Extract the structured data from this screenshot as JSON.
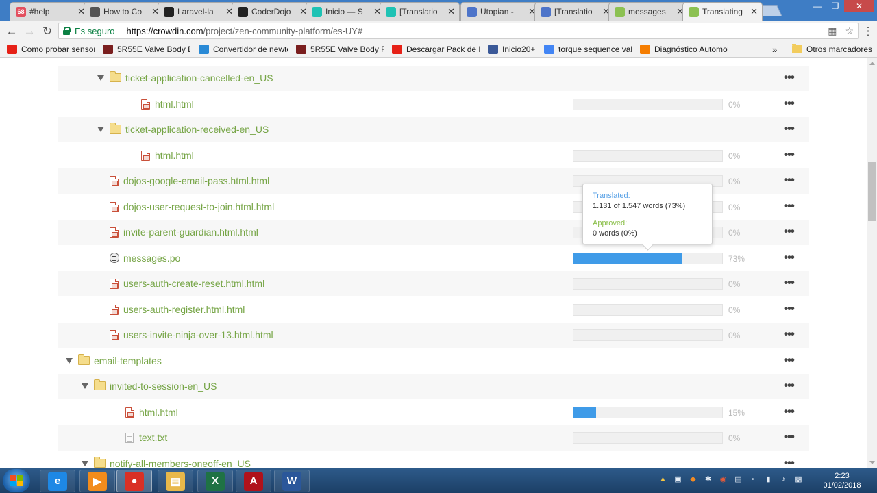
{
  "browser": {
    "tabs": [
      {
        "title": "#help",
        "favicon": "slack-icon",
        "color": "#e34f5e",
        "badge": "68"
      },
      {
        "title": "How to Co",
        "favicon": "steem-icon",
        "color": "#555555"
      },
      {
        "title": "Laravel-la",
        "favicon": "github-icon",
        "color": "#222222"
      },
      {
        "title": "CoderDojo",
        "favicon": "github-icon",
        "color": "#222222"
      },
      {
        "title": "Inicio — S",
        "favicon": "steemit-icon",
        "color": "#1ec2b4"
      },
      {
        "title": "[Translatio",
        "favicon": "steemit-icon",
        "color": "#1ec2b4"
      },
      {
        "title": "Utopian -",
        "favicon": "utopian-icon",
        "color": "#4d74c9"
      },
      {
        "title": "[Translatio",
        "favicon": "utopian-icon",
        "color": "#4d74c9"
      },
      {
        "title": "messages",
        "favicon": "crowdin-icon",
        "color": "#8cc152"
      },
      {
        "title": "Translating",
        "favicon": "crowdin-icon",
        "color": "#8cc152",
        "active": true
      }
    ],
    "omnibox": {
      "secure_label": "Es seguro",
      "url_host": "https://crowdin.com",
      "url_path": "/project/zen-community-platform/es-UY#"
    },
    "bookmarks": [
      {
        "label": "Como probar sensor",
        "icon": "youtube-icon",
        "color": "#e62117"
      },
      {
        "label": "5R55E Valve Body Bo",
        "icon": "car-icon",
        "color": "#7a1e1e"
      },
      {
        "label": "Convertidor de newto",
        "icon": "ac-icon",
        "color": "#2a8ad6"
      },
      {
        "label": "5R55E Valve Body Re",
        "icon": "car-icon",
        "color": "#7a1e1e"
      },
      {
        "label": "Descargar Pack de Di",
        "icon": "youtube-icon",
        "color": "#e62117"
      },
      {
        "label": "Inicio20+",
        "icon": "facebook-icon",
        "color": "#3b5998"
      },
      {
        "label": "torque sequence valv",
        "icon": "google-icon",
        "color": "#4285f4"
      },
      {
        "label": "Diagnóstico Automot",
        "icon": "blogger-icon",
        "color": "#f57d00"
      }
    ],
    "other_bookmarks": "Otros marcadores"
  },
  "files": [
    {
      "type": "folder",
      "name": "ticket-application-cancelled-en_US",
      "expanded": true,
      "level": 2,
      "alt": true
    },
    {
      "type": "html",
      "name": "html.html",
      "level": 3,
      "alt": false,
      "progress": 0,
      "percent": "0%"
    },
    {
      "type": "folder",
      "name": "ticket-application-received-en_US",
      "expanded": true,
      "level": 2,
      "alt": true
    },
    {
      "type": "html",
      "name": "html.html",
      "level": 3,
      "alt": false,
      "progress": 0,
      "percent": "0%"
    },
    {
      "type": "html",
      "name": "dojos-google-email-pass.html.html",
      "level": 1,
      "alt": true,
      "progress": 0,
      "percent": "0%"
    },
    {
      "type": "html",
      "name": "dojos-user-request-to-join.html.html",
      "level": 1,
      "alt": false,
      "progress": 0,
      "percent": "0%"
    },
    {
      "type": "html",
      "name": "invite-parent-guardian.html.html",
      "level": 1,
      "alt": true,
      "progress": 0,
      "percent": "0%"
    },
    {
      "type": "po",
      "name": "messages.po",
      "level": 1,
      "alt": false,
      "progress": 73,
      "percent": "73%"
    },
    {
      "type": "html",
      "name": "users-auth-create-reset.html.html",
      "level": 1,
      "alt": true,
      "progress": 0,
      "percent": "0%"
    },
    {
      "type": "html",
      "name": "users-auth-register.html.html",
      "level": 1,
      "alt": false,
      "progress": 0,
      "percent": "0%"
    },
    {
      "type": "html",
      "name": "users-invite-ninja-over-13.html.html",
      "level": 1,
      "alt": true,
      "progress": 0,
      "percent": "0%"
    },
    {
      "type": "folder",
      "name": "email-templates",
      "expanded": true,
      "level": 0,
      "alt": false
    },
    {
      "type": "folder",
      "name": "invited-to-session-en_US",
      "expanded": true,
      "level": 1,
      "alt": true
    },
    {
      "type": "html",
      "name": "html.html",
      "level": 2,
      "alt": false,
      "progress": 15,
      "percent": "15%"
    },
    {
      "type": "txt",
      "name": "text.txt",
      "level": 2,
      "alt": true,
      "progress": 0,
      "percent": "0%"
    },
    {
      "type": "folder",
      "name": "notify-all-members-oneoff-en_US",
      "expanded": true,
      "level": 1,
      "alt": false
    }
  ],
  "tooltip": {
    "translated_label": "Translated:",
    "translated_value": "1.131 of 1.547 words (73%)",
    "approved_label": "Approved:",
    "approved_value": "0 words (0%)"
  },
  "taskbar": {
    "apps": [
      {
        "name": "ie-icon",
        "color": "#1e88e5",
        "glyph": "e",
        "state": "pinned"
      },
      {
        "name": "media-player-icon",
        "color": "#f28c1c",
        "glyph": "▶",
        "state": "pinned"
      },
      {
        "name": "chrome-icon",
        "color": "#d93025",
        "glyph": "●",
        "state": "running"
      },
      {
        "name": "explorer-icon",
        "color": "#e8b84a",
        "glyph": "▤",
        "state": "pinned"
      },
      {
        "name": "excel-icon",
        "color": "#1f7244",
        "glyph": "X",
        "state": "pinned"
      },
      {
        "name": "acrobat-icon",
        "color": "#b0121b",
        "glyph": "A",
        "state": "pinned"
      },
      {
        "name": "word-icon",
        "color": "#2b579a",
        "glyph": "W",
        "state": "pinned"
      }
    ],
    "time": "2:23",
    "date": "01/02/2018"
  }
}
